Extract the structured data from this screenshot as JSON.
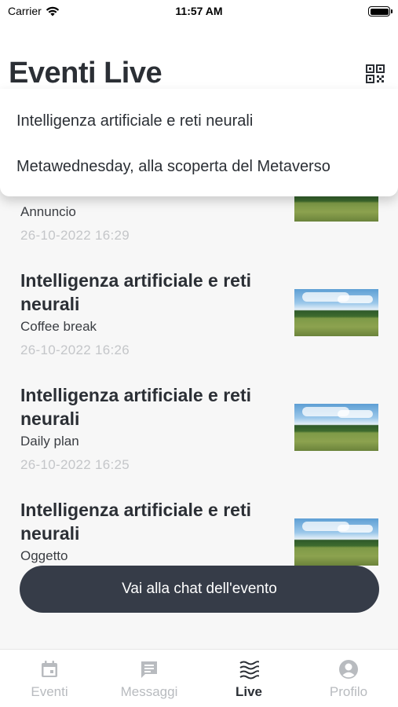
{
  "status_bar": {
    "carrier": "Carrier",
    "time": "11:57 AM",
    "icons": [
      "wifi-icon",
      "battery-icon"
    ]
  },
  "header": {
    "title": "Eventi Live",
    "qr_icon": "qr-code-icon"
  },
  "dropdown": {
    "items": [
      "Intelligenza artificiale e reti neurali",
      "Metawednesday, alla scoperta del Metaverso"
    ]
  },
  "feed": {
    "first_partial": {
      "subtitle": "Annuncio",
      "date": "26-10-2022 16:29"
    },
    "items": [
      {
        "title": "Intelligenza artificiale e reti neurali",
        "subtitle": "Coffee break",
        "date": "26-10-2022 16:26"
      },
      {
        "title": "Intelligenza artificiale e reti neurali",
        "subtitle": "Daily plan",
        "date": "26-10-2022 16:25"
      },
      {
        "title": "Intelligenza artificiale e reti neurali",
        "subtitle": "Oggetto",
        "date": ""
      }
    ]
  },
  "chat_button": {
    "label": "Vai alla chat dell'evento"
  },
  "tab_bar": {
    "tabs": [
      {
        "label": "Eventi",
        "icon": "calendar-icon",
        "active": false
      },
      {
        "label": "Messaggi",
        "icon": "message-icon",
        "active": false
      },
      {
        "label": "Live",
        "icon": "waves-icon",
        "active": true
      },
      {
        "label": "Profilo",
        "icon": "profile-icon",
        "active": false
      }
    ]
  },
  "colors": {
    "text_primary": "#2b2f35",
    "text_muted": "#c4c6c9",
    "button_dark": "#363c48",
    "tab_inactive": "#b8bbbf"
  }
}
